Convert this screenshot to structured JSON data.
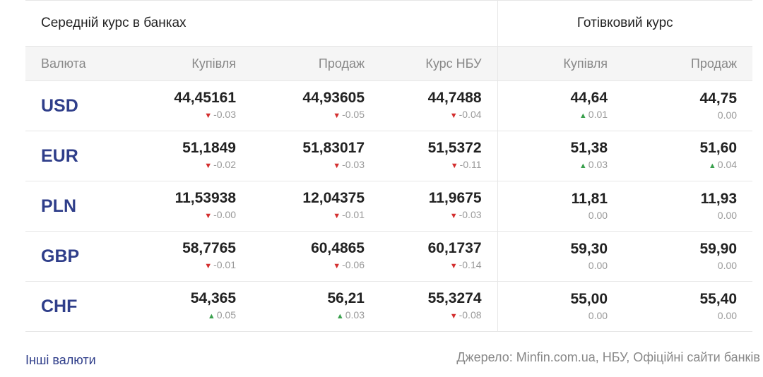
{
  "table": {
    "group_left": "Середній курс в банках",
    "group_right": "Готівковий курс",
    "headers": {
      "currency": "Валюта",
      "buy": "Купівля",
      "sell": "Продаж",
      "nbu": "Курс НБУ",
      "cash_buy": "Купівля",
      "cash_sell": "Продаж"
    },
    "rows": [
      {
        "code": "USD",
        "cells": [
          {
            "value": "44,45161",
            "change": "-0.03",
            "dir": "down"
          },
          {
            "value": "44,93605",
            "change": "-0.05",
            "dir": "down"
          },
          {
            "value": "44,7488",
            "change": "-0.04",
            "dir": "down"
          },
          {
            "value": "44,64",
            "change": "0.01",
            "dir": "up"
          },
          {
            "value": "44,75",
            "change": "0.00",
            "dir": "none"
          }
        ]
      },
      {
        "code": "EUR",
        "cells": [
          {
            "value": "51,1849",
            "change": "-0.02",
            "dir": "down"
          },
          {
            "value": "51,83017",
            "change": "-0.03",
            "dir": "down"
          },
          {
            "value": "51,5372",
            "change": "-0.11",
            "dir": "down"
          },
          {
            "value": "51,38",
            "change": "0.03",
            "dir": "up"
          },
          {
            "value": "51,60",
            "change": "0.04",
            "dir": "up"
          }
        ]
      },
      {
        "code": "PLN",
        "cells": [
          {
            "value": "11,53938",
            "change": "-0.00",
            "dir": "down"
          },
          {
            "value": "12,04375",
            "change": "-0.01",
            "dir": "down"
          },
          {
            "value": "11,9675",
            "change": "-0.03",
            "dir": "down"
          },
          {
            "value": "11,81",
            "change": "0.00",
            "dir": "none"
          },
          {
            "value": "11,93",
            "change": "0.00",
            "dir": "none"
          }
        ]
      },
      {
        "code": "GBP",
        "cells": [
          {
            "value": "58,7765",
            "change": "-0.01",
            "dir": "down"
          },
          {
            "value": "60,4865",
            "change": "-0.06",
            "dir": "down"
          },
          {
            "value": "60,1737",
            "change": "-0.14",
            "dir": "down"
          },
          {
            "value": "59,30",
            "change": "0.00",
            "dir": "none"
          },
          {
            "value": "59,90",
            "change": "0.00",
            "dir": "none"
          }
        ]
      },
      {
        "code": "CHF",
        "cells": [
          {
            "value": "54,365",
            "change": "0.05",
            "dir": "up"
          },
          {
            "value": "56,21",
            "change": "0.03",
            "dir": "up"
          },
          {
            "value": "55,3274",
            "change": "-0.08",
            "dir": "down"
          },
          {
            "value": "55,00",
            "change": "0.00",
            "dir": "none"
          },
          {
            "value": "55,40",
            "change": "0.00",
            "dir": "none"
          }
        ]
      }
    ]
  },
  "footer": {
    "other_link": "Інші валюти",
    "source": "Джерело: Minfin.com.ua, НБУ, Офіційні сайти банків"
  },
  "colors": {
    "currency_code": "#2f3e8a",
    "down": "#d32f2f",
    "up": "#3aa04d",
    "muted": "#888888"
  },
  "icons": {
    "down": "triangle-down-icon",
    "up": "triangle-up-icon"
  }
}
